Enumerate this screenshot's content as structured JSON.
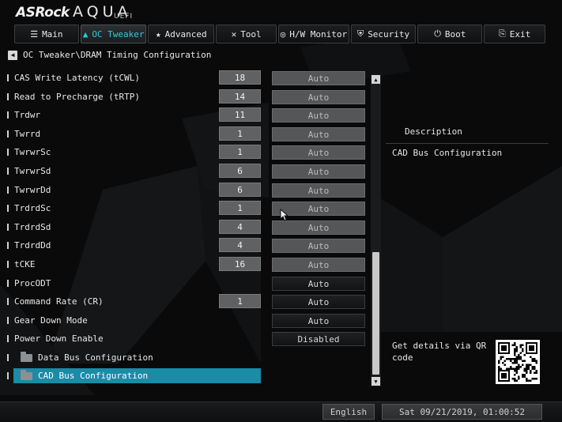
{
  "brand": {
    "logo": "ASRock",
    "product": "AQUA",
    "edition": "UEFI"
  },
  "menu": [
    {
      "label": "Main",
      "icon": "list-icon",
      "glyph": "☰",
      "active": false
    },
    {
      "label": "OC Tweaker",
      "icon": "flame-icon",
      "glyph": "▲",
      "active": true
    },
    {
      "label": "Advanced",
      "icon": "star-icon",
      "glyph": "★",
      "active": false
    },
    {
      "label": "Tool",
      "icon": "tools-icon",
      "glyph": "✕",
      "active": false
    },
    {
      "label": "H/W Monitor",
      "icon": "monitor-icon",
      "glyph": "◎",
      "active": false
    },
    {
      "label": "Security",
      "icon": "shield-icon",
      "glyph": "⛨",
      "active": false
    },
    {
      "label": "Boot",
      "icon": "power-icon",
      "glyph": "⏻",
      "active": false
    },
    {
      "label": "Exit",
      "icon": "exit-icon",
      "glyph": "⎘",
      "active": false
    }
  ],
  "breadcrumb": "OC Tweaker\\DRAM Timing Configuration",
  "settings": [
    {
      "label": "CAS Write Latency (tCWL)",
      "value": "18",
      "option": "Auto",
      "style": "grey"
    },
    {
      "label": "Read to Precharge (tRTP)",
      "value": "14",
      "option": "Auto",
      "style": "grey"
    },
    {
      "label": "Trdwr",
      "value": "11",
      "option": "Auto",
      "style": "grey"
    },
    {
      "label": "Twrrd",
      "value": "1",
      "option": "Auto",
      "style": "grey"
    },
    {
      "label": "TwrwrSc",
      "value": "1",
      "option": "Auto",
      "style": "grey"
    },
    {
      "label": "TwrwrSd",
      "value": "6",
      "option": "Auto",
      "style": "grey"
    },
    {
      "label": "TwrwrDd",
      "value": "6",
      "option": "Auto",
      "style": "grey"
    },
    {
      "label": "TrdrdSc",
      "value": "1",
      "option": "Auto",
      "style": "grey"
    },
    {
      "label": "TrdrdSd",
      "value": "4",
      "option": "Auto",
      "style": "grey"
    },
    {
      "label": "TrdrdDd",
      "value": "4",
      "option": "Auto",
      "style": "grey"
    },
    {
      "label": "tCKE",
      "value": "16",
      "option": "Auto",
      "style": "grey"
    },
    {
      "label": "ProcODT",
      "value": "",
      "option": "Auto",
      "style": "dark"
    },
    {
      "label": "Command Rate (CR)",
      "value": "1",
      "option": "Auto",
      "style": "dark"
    },
    {
      "label": "Gear Down Mode",
      "value": "",
      "option": "Auto",
      "style": "dark"
    },
    {
      "label": "Power Down Enable",
      "value": "",
      "option": "Disabled",
      "style": "dark"
    }
  ],
  "submenus": [
    {
      "label": "Data Bus Configuration",
      "selected": false
    },
    {
      "label": "CAD Bus Configuration",
      "selected": true
    }
  ],
  "description": {
    "title": "Description",
    "text": "CAD Bus Configuration"
  },
  "qr_caption": "Get details via QR code",
  "footer": {
    "language": "English",
    "datetime": "Sat 09/21/2019, 01:00:52"
  },
  "colors": {
    "accent": "#36c7da",
    "selection": "#1a8ca6"
  }
}
